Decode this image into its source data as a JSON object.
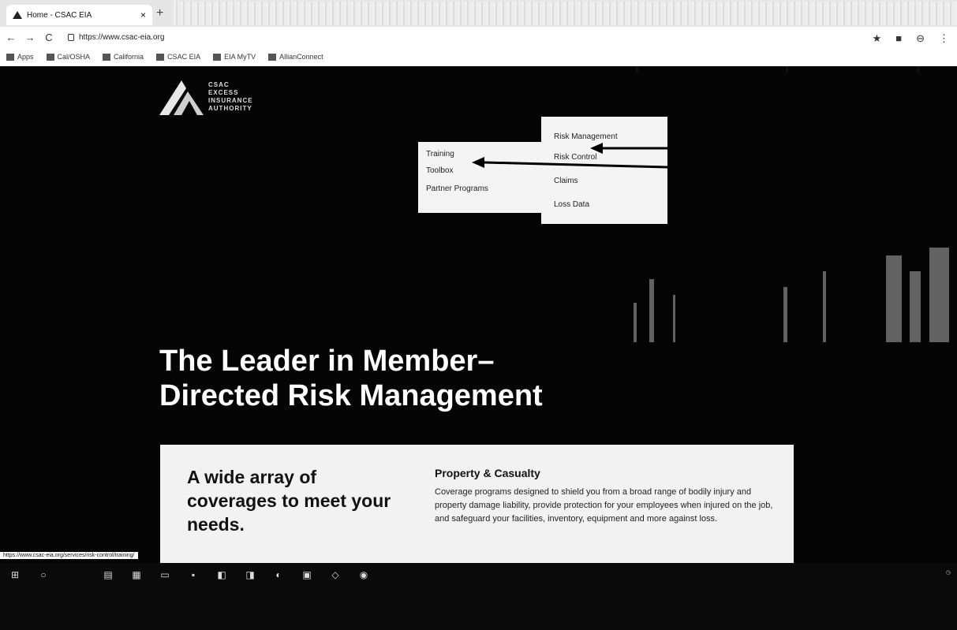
{
  "browser": {
    "tab_title": "Home - CSAC EIA",
    "tab_close": "×",
    "new_tab": "+",
    "url": "https://www.csac-eia.org",
    "nav_back": "←",
    "nav_forward": "→",
    "nav_reload": "C",
    "bookmarks": [
      {
        "label": "Apps"
      },
      {
        "label": "Cal/OSHA"
      },
      {
        "label": "California"
      },
      {
        "label": "CSAC EIA"
      },
      {
        "label": "EIA MyTV"
      },
      {
        "label": "AllianConnect"
      }
    ],
    "status_url": "https://www.csac-eia.org/services/risk-control/training/"
  },
  "logo": {
    "lines": [
      "CSAC",
      "EXCESS",
      "INSURANCE",
      "AUTHORITY"
    ]
  },
  "menu": {
    "items": [
      "Risk Management",
      "Risk Control",
      "Claims",
      "Loss Data"
    ],
    "submenu": [
      "Training",
      "Toolbox",
      "Partner Programs"
    ]
  },
  "hero": {
    "headline_line1": "The Leader in Member–",
    "headline_line2": "Directed Risk Management"
  },
  "card": {
    "title": "A wide array of coverages to meet your needs.",
    "pc_title": "Property & Casualty",
    "pc_desc": "Coverage programs designed to shield you from a broad range of bodily injury and property damage liability, provide protection for your employees when injured on the job, and safeguard your facilities, inventory, equipment and more against loss."
  },
  "colors": {
    "hero_bg": "#050505",
    "panel_bg": "#f4f4f4",
    "text_light": "#ffffff"
  }
}
